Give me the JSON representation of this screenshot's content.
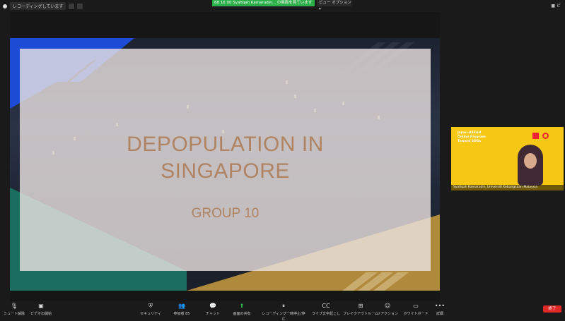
{
  "top_bar": {
    "recording_label": "レコーディングしています",
    "screen_share_banner": "68 16 00 Syafiqah Kamarudin... の画面を見ています",
    "view_options": "ビュー オプション ▾",
    "top_right_label": "■ ビ"
  },
  "slide": {
    "title_line1": "DEPOPULATION IN",
    "title_line2": "SINGAPORE",
    "subtitle": "GROUP 10"
  },
  "video": {
    "banner_text": "Japan-ASEAN Online Program Toward SDGs",
    "participant_name": "Syafiqah Kamarudin_Universiti Kebangsaan Malaysia"
  },
  "toolbar": {
    "items": [
      {
        "icon": "microphone-icon",
        "glyph": "🎙",
        "label": "ミュート解除"
      },
      {
        "icon": "video-camera-icon",
        "glyph": "▣",
        "label": "ビデオの開始"
      },
      {
        "icon": "security-icon",
        "glyph": "⛨",
        "label": "セキュリティ"
      },
      {
        "icon": "participants-icon",
        "glyph": "👥",
        "label": "参加者 85"
      },
      {
        "icon": "chat-icon",
        "glyph": "💬",
        "label": "チャット"
      },
      {
        "icon": "share-screen-icon",
        "glyph": "⬆",
        "label": "画面の共有"
      },
      {
        "icon": "recording-icon",
        "glyph": "⏸",
        "label": "レコーディング一時停止/停止"
      },
      {
        "icon": "captions-icon",
        "glyph": "CC",
        "label": "ライブ文字起こし"
      },
      {
        "icon": "breakout-rooms-icon",
        "glyph": "⊞",
        "label": "ブレイクアウトルーム"
      },
      {
        "icon": "reactions-icon",
        "glyph": "☺",
        "label": "リアクション"
      },
      {
        "icon": "whiteboard-icon",
        "glyph": "▭",
        "label": "ホワイトボード"
      },
      {
        "icon": "more-icon",
        "glyph": "•••",
        "label": "詳細"
      }
    ],
    "end_label": "終了"
  },
  "colors": {
    "slide_text": "#b08462",
    "stripe_blue": "#1d4bd6",
    "stripe_teal": "#1b6e5f",
    "stripe_gold": "#b08a3c",
    "share_green": "#2db04a",
    "end_red": "#e02828",
    "video_bg": "#f6c814"
  }
}
